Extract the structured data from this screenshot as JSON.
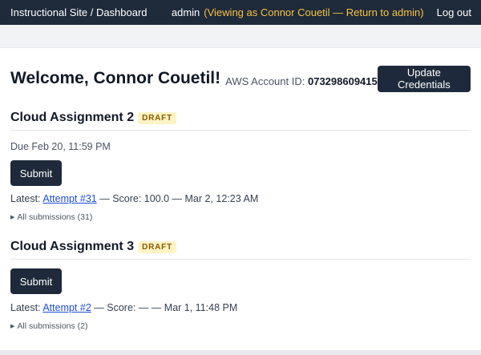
{
  "topbar": {
    "brand": "Instructional Site / Dashboard",
    "user": "admin",
    "viewing_as": "(Viewing as Connor Couetil — Return to admin)",
    "logout": "Log out"
  },
  "header": {
    "welcome": "Welcome, Connor Couetil!",
    "aws_label": "AWS Account ID:",
    "aws_account_id": "073298609415",
    "update_button": "Update Credentials"
  },
  "assignments": [
    {
      "title": "Cloud Assignment 2",
      "badge": "DRAFT",
      "due": "Due Feb 20, 11:59 PM",
      "submit_label": "Submit",
      "latest_prefix": "Latest:",
      "latest_link": "Attempt #31",
      "latest_suffix": "— Score: 100.0 — Mar 2, 12:23 AM",
      "all_submissions": "All submissions (31)"
    },
    {
      "title": "Cloud Assignment 3",
      "badge": "DRAFT",
      "submit_label": "Submit",
      "latest_prefix": "Latest:",
      "latest_link": "Attempt #2",
      "latest_suffix": "— Score: — — Mar 1, 11:48 PM",
      "all_submissions": "All submissions (2)"
    }
  ],
  "colors": {
    "topbar_bg": "#1f2a3a",
    "viewing_as_text": "#f5c443",
    "button_bg": "#1e2a3b",
    "badge_bg": "#fdf3c4",
    "badge_text": "#8a5a00",
    "link": "#1d4ed8"
  }
}
